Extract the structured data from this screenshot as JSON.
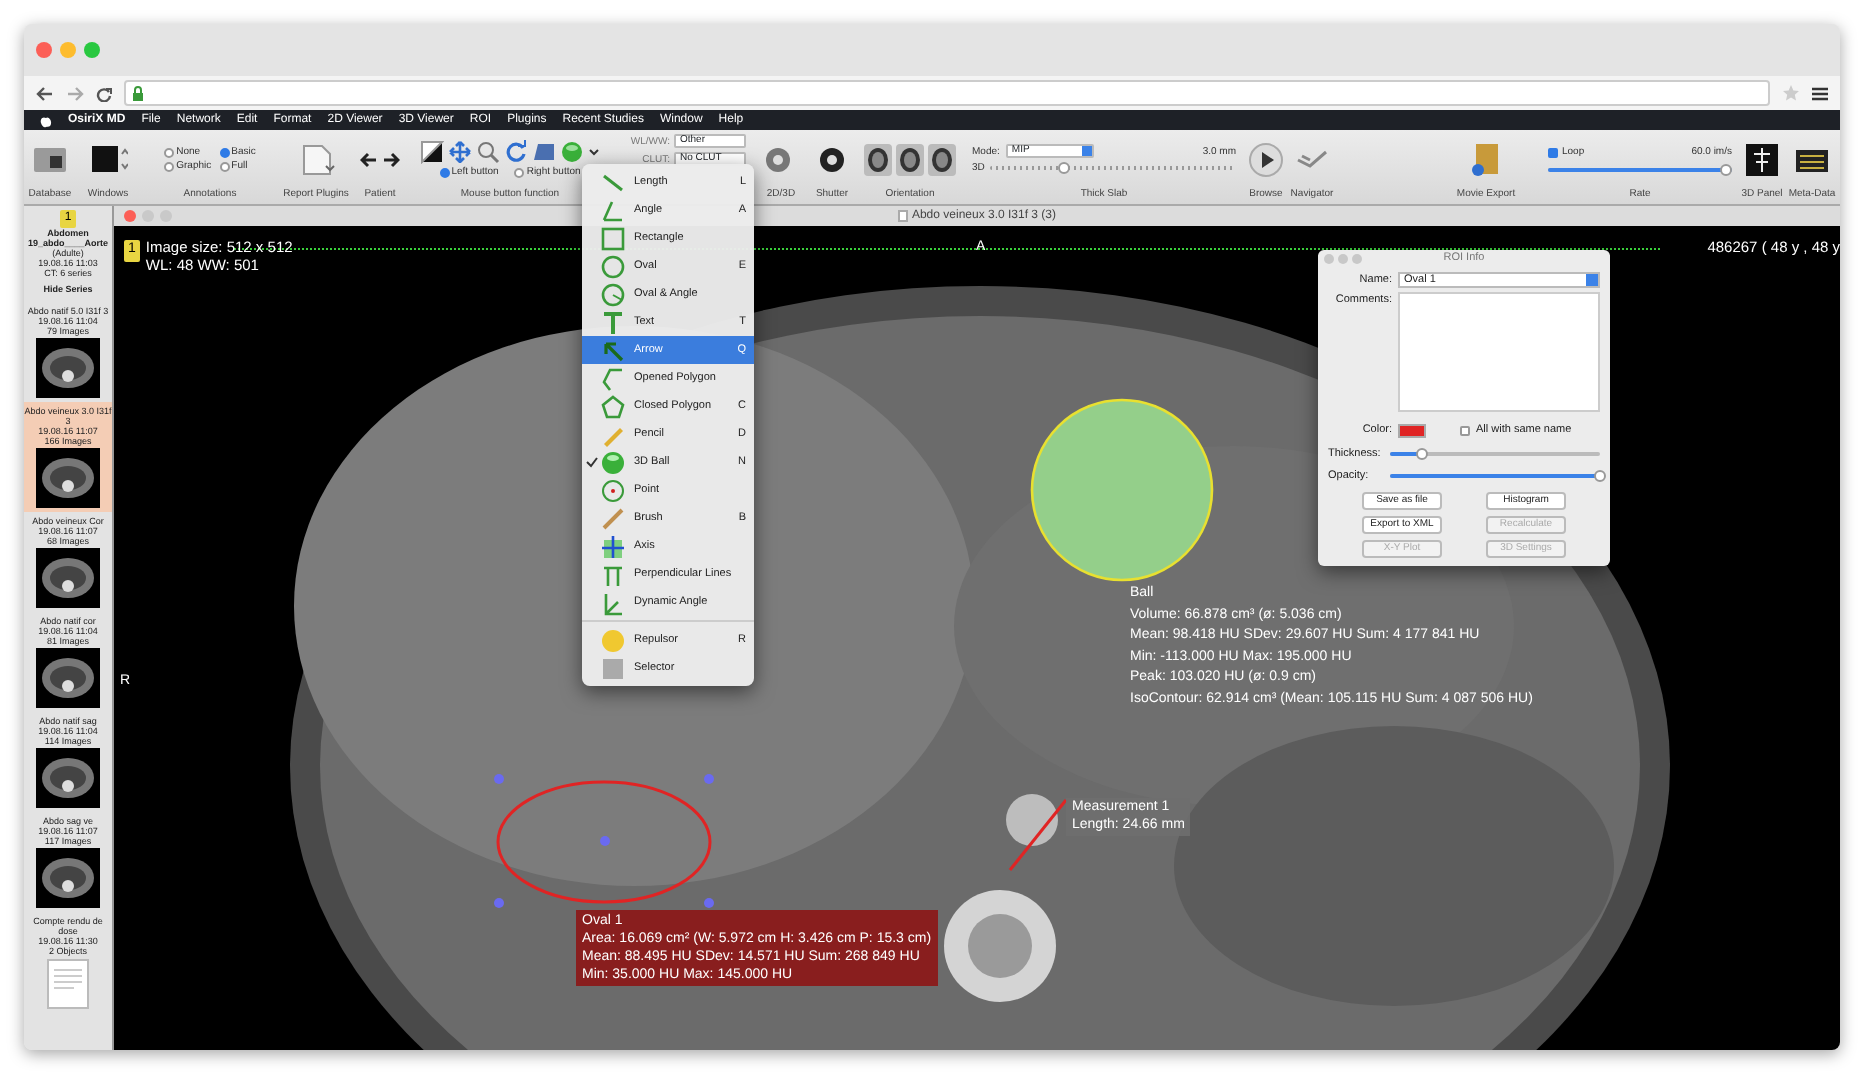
{
  "menu_bar": {
    "items": [
      "OsiriX MD",
      "File",
      "Network",
      "Edit",
      "Format",
      "2D Viewer",
      "3D Viewer",
      "ROI",
      "Plugins",
      "Recent Studies",
      "Window",
      "Help"
    ]
  },
  "toolbar": [
    {
      "kind": "icon",
      "label": "Database"
    },
    {
      "kind": "icon",
      "label": "Windows"
    },
    {
      "kind": "radios",
      "label": "Annotations",
      "options": [
        {
          "label": "None",
          "selected": false
        },
        {
          "label": "Basic",
          "selected": true
        },
        {
          "label": "Graphic",
          "selected": false
        },
        {
          "label": "Full",
          "selected": false
        }
      ]
    },
    {
      "kind": "icon",
      "label": "Report Plugins"
    },
    {
      "kind": "arrows",
      "label": "Patient"
    },
    {
      "kind": "tools",
      "label": "Mouse button function",
      "options": [
        {
          "label": "Left button",
          "selected": true
        },
        {
          "label": "Right button",
          "selected": false
        }
      ]
    },
    {
      "kind": "selects",
      "fields": [
        {
          "label": "WL/WW:",
          "value": "Other"
        },
        {
          "label": "CLUT:",
          "value": "No CLUT"
        }
      ]
    },
    {
      "kind": "icon",
      "label": "2D/3D"
    },
    {
      "kind": "icon",
      "label": "Shutter"
    },
    {
      "kind": "heads",
      "label": "Orientation"
    },
    {
      "kind": "slab",
      "label": "Thick Slab",
      "mode_label": "Mode:",
      "mode": "MIP",
      "prefix": "3D",
      "reading": "3.0 mm",
      "level": 0.3
    },
    {
      "kind": "icon",
      "label": "Browse"
    },
    {
      "kind": "icon",
      "label": "Navigator"
    },
    {
      "kind": "icon",
      "label": "Movie Export"
    },
    {
      "kind": "rate",
      "label": "Rate",
      "loop": {
        "label": "Loop",
        "checked": true
      },
      "reading": "60.0 im/s",
      "level": 1
    },
    {
      "kind": "icon",
      "label": "3D Panel"
    },
    {
      "kind": "icon",
      "label": "Meta-Data"
    }
  ],
  "sidebar": {
    "badge": "1",
    "study": [
      "Abdomen",
      "19_abdo____Aorte",
      "(Adulte)",
      "19.08.16 11:03",
      "CT: 6 series"
    ],
    "hide_button": "Hide Series",
    "series": [
      {
        "kind": "image",
        "selected": false,
        "lines": [
          "Abdo natif 5.0 I31f 3",
          "19.08.16 11:04",
          "79 Images"
        ]
      },
      {
        "kind": "image",
        "selected": true,
        "lines": [
          "Abdo veineux 3.0 I31f 3",
          "19.08.16 11:07",
          "166 Images"
        ]
      },
      {
        "kind": "image",
        "selected": false,
        "lines": [
          "Abdo veineux Cor",
          "19.08.16 11:07",
          "68 Images"
        ]
      },
      {
        "kind": "image",
        "selected": false,
        "lines": [
          "Abdo natif cor",
          "19.08.16 11:04",
          "81 Images"
        ]
      },
      {
        "kind": "image",
        "selected": false,
        "lines": [
          "Abdo natif sag",
          "19.08.16 11:04",
          "114 Images"
        ]
      },
      {
        "kind": "image",
        "selected": false,
        "lines": [
          "Abdo sag ve",
          "19.08.16 11:07",
          "117 Images"
        ]
      },
      {
        "kind": "document",
        "selected": false,
        "lines": [
          "Compte rendu de dose",
          "19.08.16 11:30",
          "2 Objects"
        ]
      }
    ]
  },
  "viewer": {
    "title": "Abdo veineux 3.0 I31f 3 (3)",
    "badge": "1",
    "image_size": "Image size: 512 x 512",
    "window_level": "WL: 48 WW: 501",
    "patient_info": "486267 ( 48 y , 48 y",
    "orientation_top": "A",
    "orientation_left": "R",
    "rois": [
      {
        "kind": "ball",
        "lines": [
          "Ball",
          "Volume: 66.878 cm³ (ø: 5.036 cm)",
          "Mean: 98.418 HU SDev: 29.607 HU Sum: 4 177 841 HU",
          "Min: -113.000 HU Max: 195.000 HU",
          "Peak: 103.020 HU (ø: 0.9 cm)",
          "IsoContour: 62.914 cm³ (Mean: 105.115 HU Sum: 4 087 506 HU)"
        ]
      },
      {
        "kind": "measurement",
        "lines": [
          "Measurement 1",
          "Length: 24.66 mm"
        ]
      },
      {
        "kind": "oval",
        "lines": [
          "Oval 1",
          "Area: 16.069 cm² (W: 5.972 cm H: 3.426 cm P: 15.3 cm)",
          "Mean: 88.495 HU SDev: 14.571 HU Sum: 268 849 HU",
          "Min: 35.000 HU Max: 145.000 HU"
        ]
      }
    ]
  },
  "roi_menu": {
    "items": [
      {
        "label": "Length",
        "shortcut": "L",
        "selected": false,
        "checked": false
      },
      {
        "label": "Angle",
        "shortcut": "A",
        "selected": false,
        "checked": false
      },
      {
        "label": "Rectangle",
        "selected": false,
        "checked": false
      },
      {
        "label": "Oval",
        "shortcut": "E",
        "selected": false,
        "checked": false
      },
      {
        "label": "Oval & Angle",
        "selected": false,
        "checked": false
      },
      {
        "label": "Text",
        "shortcut": "T",
        "selected": false,
        "checked": false
      },
      {
        "label": "Arrow",
        "shortcut": "Q",
        "selected": true,
        "checked": false
      },
      {
        "label": "Opened Polygon",
        "selected": false,
        "checked": false
      },
      {
        "label": "Closed Polygon",
        "shortcut": "C",
        "selected": false,
        "checked": false
      },
      {
        "label": "Pencil",
        "shortcut": "D",
        "selected": false,
        "checked": false
      },
      {
        "label": "3D Ball",
        "shortcut": "N",
        "selected": false,
        "checked": true
      },
      {
        "label": "Point",
        "selected": false,
        "checked": false
      },
      {
        "label": "Brush",
        "shortcut": "B",
        "selected": false,
        "checked": false
      },
      {
        "label": "Axis",
        "selected": false,
        "checked": false
      },
      {
        "label": "Perpendicular Lines",
        "selected": false,
        "checked": false
      },
      {
        "label": "Dynamic Angle",
        "selected": false,
        "checked": false
      },
      {
        "label": "Repulsor",
        "shortcut": "R",
        "selected": false,
        "checked": false,
        "separator_before": true
      },
      {
        "label": "Selector",
        "selected": false,
        "checked": false
      }
    ]
  },
  "roi_info": {
    "title": "ROI Info",
    "name_label": "Name:",
    "name": "Oval 1",
    "comments_label": "Comments:",
    "color_label": "Color:",
    "color": "#e02424",
    "same_name": {
      "label": "All with same name",
      "checked": false
    },
    "thickness_label": "Thickness:",
    "thickness": {
      "level": 0.15
    },
    "opacity_label": "Opacity:",
    "opacity": {
      "level": 1
    },
    "buttons": [
      {
        "label": "Save as file",
        "disabled": false
      },
      {
        "label": "Histogram",
        "disabled": false
      },
      {
        "label": "Export to XML",
        "disabled": false
      },
      {
        "label": "Recalculate",
        "disabled": true
      },
      {
        "label": "X-Y Plot",
        "disabled": true
      },
      {
        "label": "3D Settings",
        "disabled": true
      }
    ]
  }
}
